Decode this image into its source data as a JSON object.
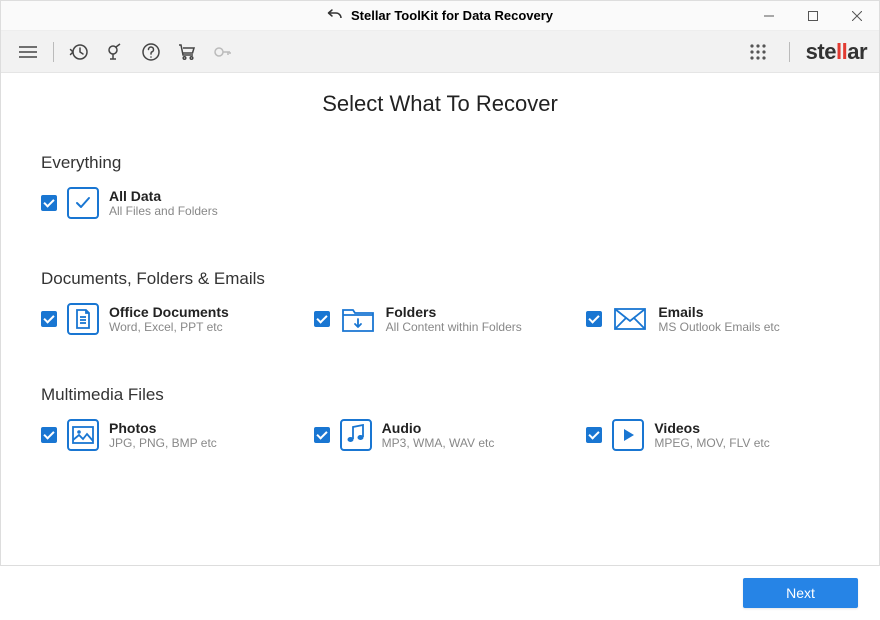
{
  "app": {
    "title": "Stellar ToolKit for Data Recovery",
    "brand": "stellar"
  },
  "page": {
    "title": "Select What To Recover"
  },
  "sections": {
    "everything": {
      "title": "Everything",
      "alldata": {
        "title": "All Data",
        "sub": "All Files and Folders"
      }
    },
    "docs": {
      "title": "Documents, Folders & Emails",
      "office": {
        "title": "Office Documents",
        "sub": "Word, Excel, PPT etc"
      },
      "folders": {
        "title": "Folders",
        "sub": "All Content within Folders"
      },
      "emails": {
        "title": "Emails",
        "sub": "MS Outlook Emails etc"
      }
    },
    "media": {
      "title": "Multimedia Files",
      "photos": {
        "title": "Photos",
        "sub": "JPG, PNG, BMP etc"
      },
      "audio": {
        "title": "Audio",
        "sub": "MP3, WMA, WAV etc"
      },
      "videos": {
        "title": "Videos",
        "sub": "MPEG, MOV, FLV etc"
      }
    }
  },
  "buttons": {
    "next": "Next"
  }
}
